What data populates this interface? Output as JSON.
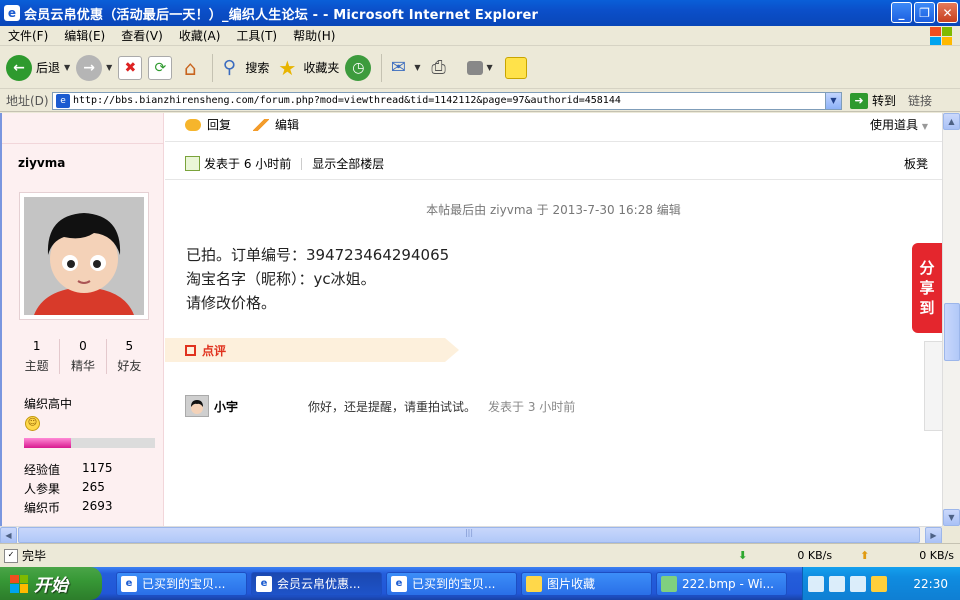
{
  "window": {
    "title": "会员云帛优惠（活动最后一天！）_编织人生论坛 - - Microsoft Internet Explorer"
  },
  "menu": [
    "文件(F)",
    "编辑(E)",
    "查看(V)",
    "收藏(A)",
    "工具(T)",
    "帮助(H)"
  ],
  "toolbar": {
    "back": "后退",
    "search": "搜索",
    "favorites": "收藏夹"
  },
  "address": {
    "label": "地址(D)",
    "url": "http://bbs.bianzhirensheng.com/forum.php?mod=viewthread&tid=1142112&page=97&authorid=458144",
    "go": "转到",
    "links": "链接"
  },
  "sidebar": {
    "username": "ziyvma",
    "stats": [
      {
        "num": "1",
        "label": "主题"
      },
      {
        "num": "0",
        "label": "精华"
      },
      {
        "num": "5",
        "label": "好友"
      }
    ],
    "rank": "编织高中",
    "progress": 0.36,
    "props": [
      {
        "k": "经验值",
        "v": "1175"
      },
      {
        "k": "人参果",
        "v": "265"
      },
      {
        "k": "编织币",
        "v": "2693"
      }
    ]
  },
  "post": {
    "reply": "回复",
    "edit": "编辑",
    "use_tools": "使用道具",
    "posted": "发表于 6 小时前",
    "show_all": "显示全部楼层",
    "floor": "板凳",
    "edited_note": "本帖最后由 ziyvma 于 2013-7-30 16:28 编辑",
    "lines": [
      "已拍。订单编号：394723464294065",
      "淘宝名字（昵称）：yc冰姐。",
      "请修改价格。"
    ],
    "comment_label": "点评",
    "share": "分享到",
    "comment": {
      "user": "小宇",
      "text": "你好，还是提醒，请重拍试试。",
      "time": "发表于 3 小时前"
    }
  },
  "status": {
    "text": "完毕",
    "down": "0 KB/s",
    "up": "0 KB/s"
  },
  "taskbar": {
    "start": "开始",
    "tasks": [
      "已买到的宝贝...",
      "会员云帛优惠...",
      "已买到的宝贝...",
      "图片收藏",
      "222.bmp - Wi..."
    ],
    "active_index": 1,
    "clock": "22:30"
  },
  "colors": {
    "accent_pink": "#d8198f",
    "share_red": "#e4262d",
    "comment_red": "#e0321e"
  }
}
